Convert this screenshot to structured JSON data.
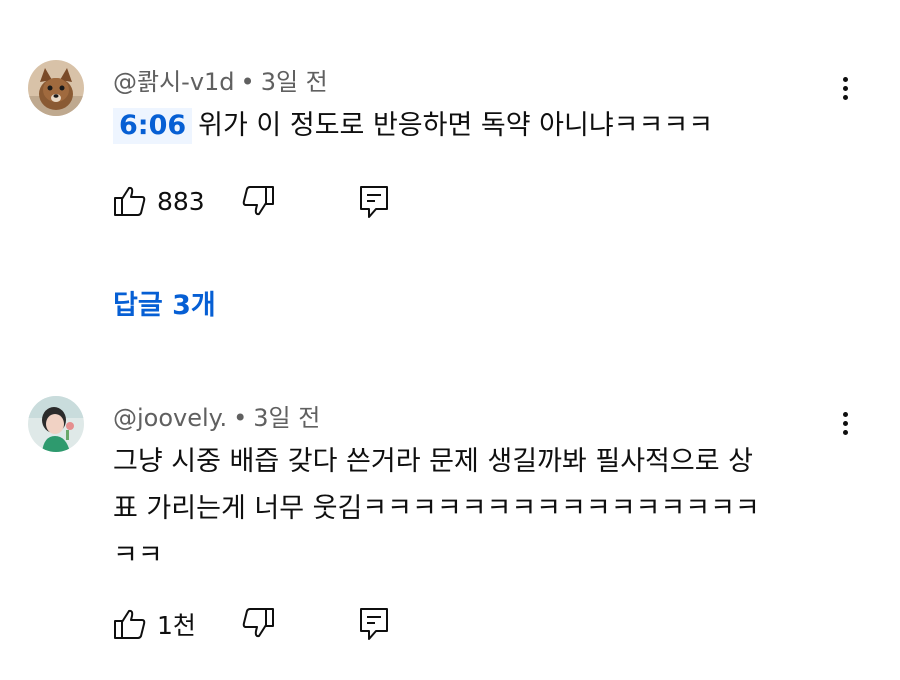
{
  "comments": [
    {
      "author": "@콹시-v1d",
      "age": "3일 전",
      "timestamp": "6:06",
      "text": "위가 이 정도로 반응하면 독약 아니냐ㅋㅋㅋㅋ",
      "likes": "883",
      "replies_label": "답글 3개"
    },
    {
      "author": "@joovely.",
      "age": "3일 전",
      "text_lines": [
        "그냥 시중 배즙 갖다 쓴거라 문제 생길까봐 필사적으로 상",
        "표 가리는게 너무 웃김ㅋㅋㅋㅋㅋㅋㅋㅋㅋㅋㅋㅋㅋㅋㅋㅋ",
        "ㅋㅋ"
      ],
      "likes": "1천"
    }
  ],
  "separator": "•",
  "icons": {
    "more": "more-vertical-icon",
    "like": "thumbs-up-icon",
    "dislike": "thumbs-down-icon",
    "reply": "reply-icon"
  },
  "colors": {
    "link": "#065fd4",
    "timestamp_bg": "#eef5ff",
    "meta": "#606060",
    "text": "#0f0f0f"
  }
}
